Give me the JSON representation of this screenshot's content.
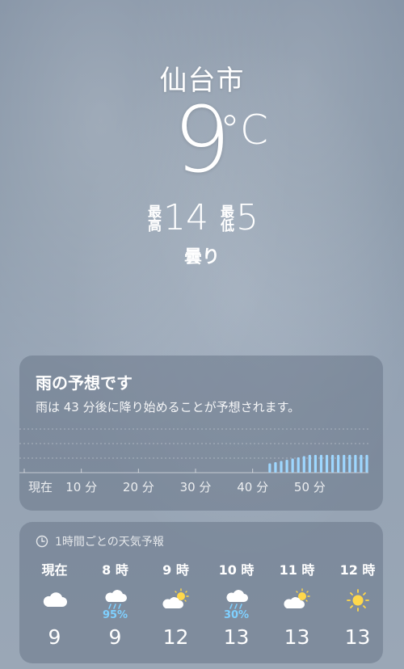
{
  "location": {
    "city": "仙台市",
    "temperature": "9",
    "unit": "°C",
    "high_label": "最高",
    "high": "14",
    "low_label": "最低",
    "low": "5",
    "condition": "曇り"
  },
  "rain": {
    "title": "雨の予想です",
    "description": "雨は 43 分後に降り始めることが予想されます。",
    "time_labels": [
      "現在",
      "10 分",
      "20 分",
      "30 分",
      "40 分",
      "50 分"
    ],
    "start_minute": 43,
    "bar_color": "#9ed7ff"
  },
  "hourly": {
    "header": "1時間ごとの天気予報",
    "hours": [
      {
        "label": "現在",
        "icon": "cloud-icon",
        "pct": "",
        "temp": "9"
      },
      {
        "label": "8 時",
        "icon": "cloud-rain-icon",
        "pct": "95%",
        "temp": "9"
      },
      {
        "label": "9 時",
        "icon": "cloud-sun-icon",
        "pct": "",
        "temp": "12"
      },
      {
        "label": "10 時",
        "icon": "cloud-rain-icon",
        "pct": "30%",
        "temp": "13"
      },
      {
        "label": "11 時",
        "icon": "cloud-sun-icon",
        "pct": "",
        "temp": "13"
      },
      {
        "label": "12 時",
        "icon": "sun-icon",
        "pct": "",
        "temp": "13"
      }
    ]
  }
}
